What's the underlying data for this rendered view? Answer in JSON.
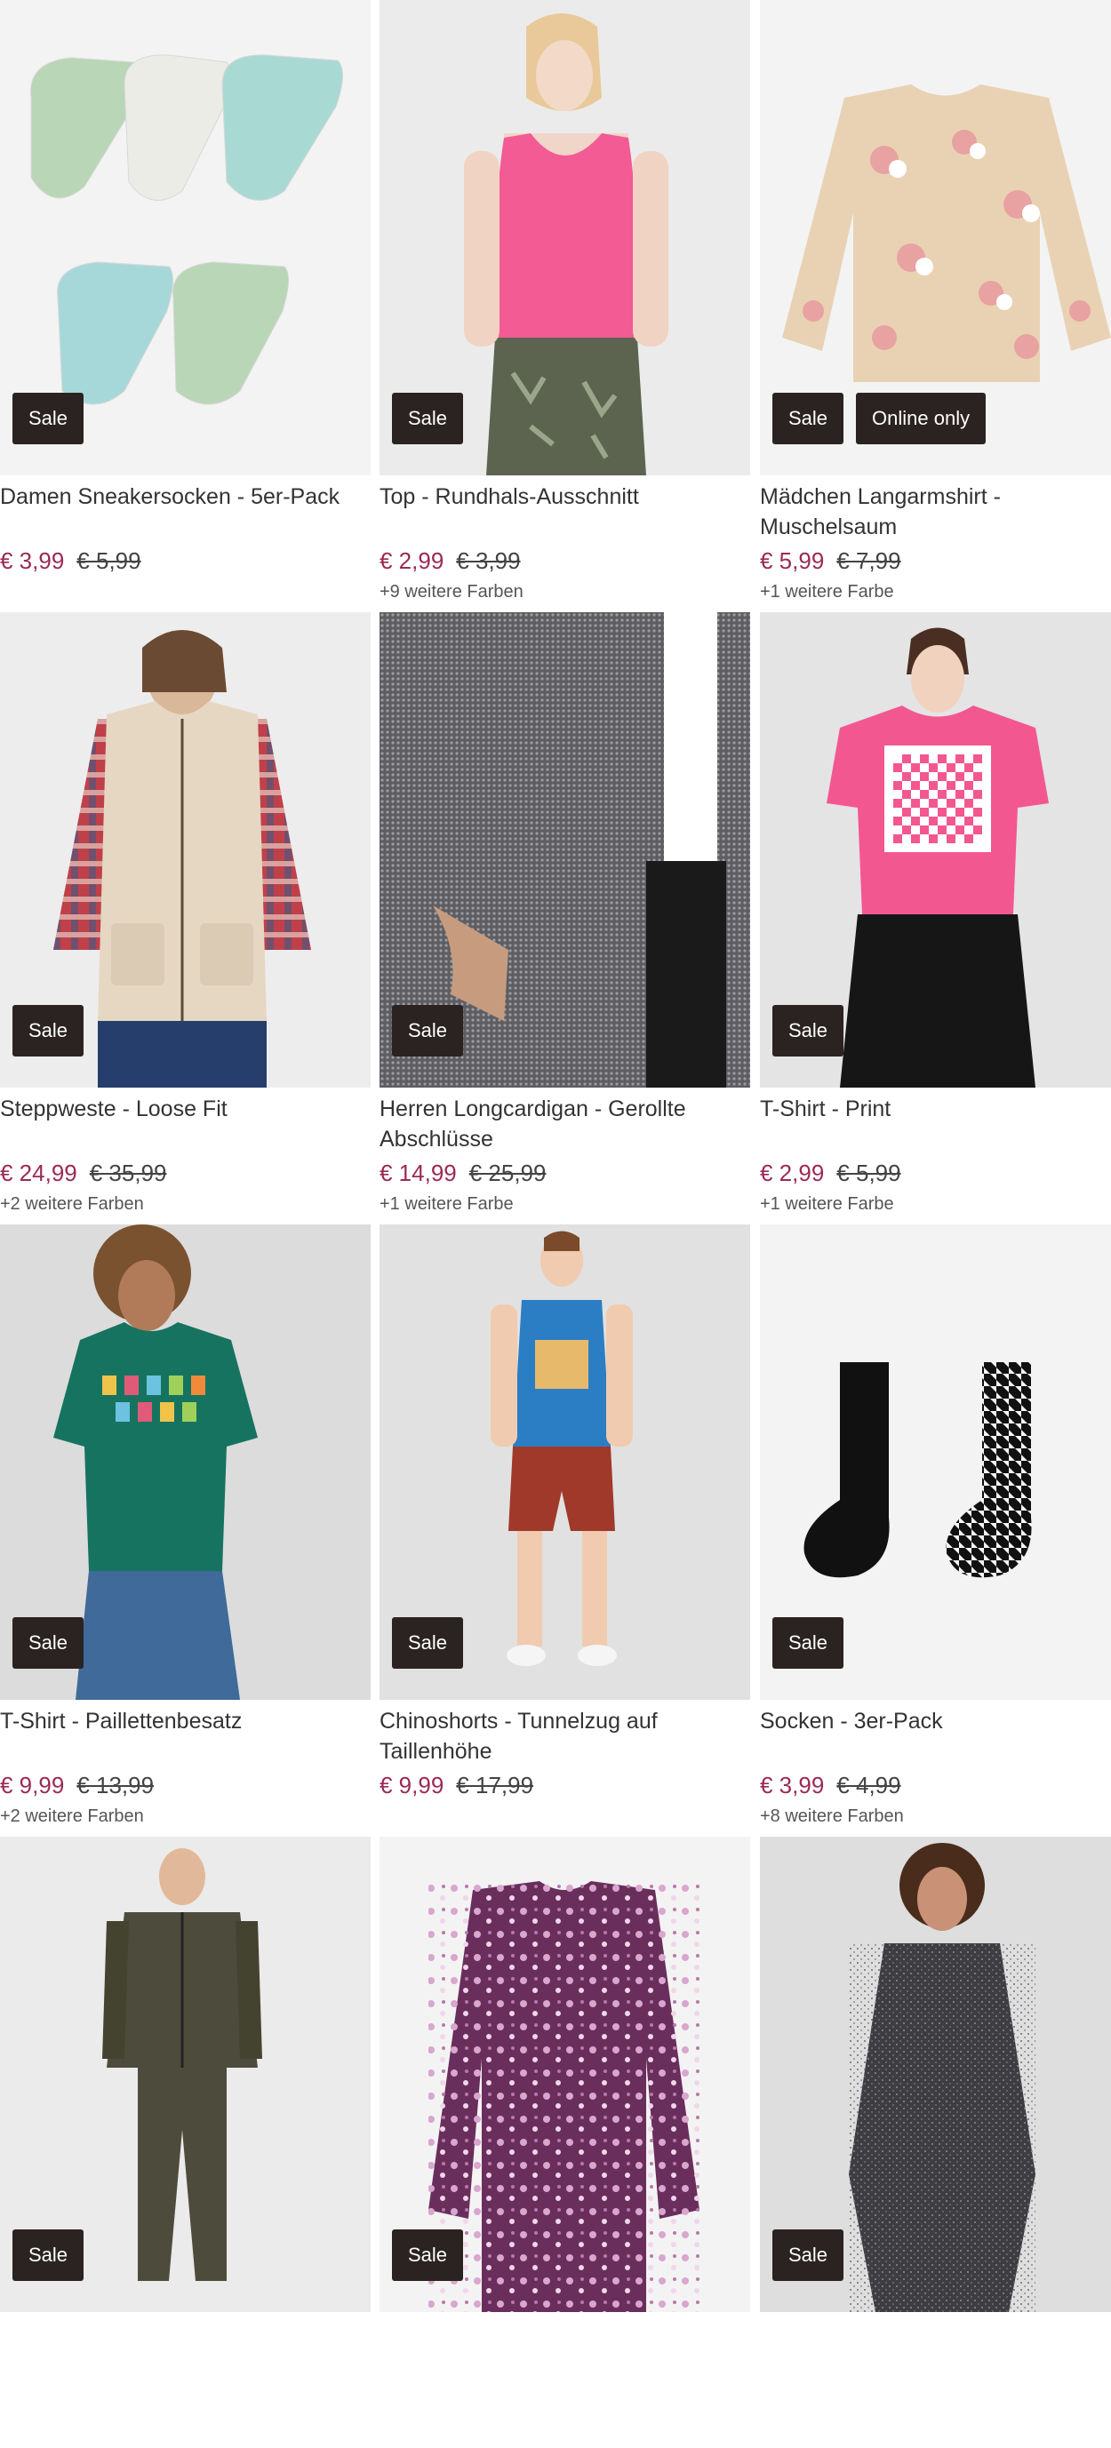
{
  "products": [
    {
      "title": "Damen Sneakersocken - 5er-Pack",
      "price": "€ 3,99",
      "old_price": "€ 5,99",
      "colors_text": "",
      "badges": [
        "Sale"
      ],
      "image": "sneaker-socks-image",
      "bg": "#f3f3f3"
    },
    {
      "title": "Top - Rundhals-Ausschnitt",
      "price": "€ 2,99",
      "old_price": "€ 3,99",
      "colors_text": "+9 weitere Farben",
      "badges": [
        "Sale"
      ],
      "image": "pink-top-image",
      "bg": "#ebebeb"
    },
    {
      "title": "Mädchen Langarmshirt - Muschelsaum",
      "price": "€ 5,99",
      "old_price": "€ 7,99",
      "colors_text": "+1 weitere Farbe",
      "badges": [
        "Sale",
        "Online only"
      ],
      "image": "unicorn-longsleeve-image",
      "bg": "#f3f3f3"
    },
    {
      "title": "Steppweste - Loose Fit",
      "price": "€ 24,99",
      "old_price": "€ 35,99",
      "colors_text": "+2 weitere Farben",
      "badges": [
        "Sale"
      ],
      "image": "puffer-vest-image",
      "bg": "#ededed"
    },
    {
      "title": "Herren Longcardigan - Gerollte Abschlüsse",
      "price": "€ 14,99",
      "old_price": "€ 25,99",
      "colors_text": "+1 weitere Farbe",
      "badges": [
        "Sale"
      ],
      "image": "knit-cardigan-image",
      "bg": "#e6e6e6"
    },
    {
      "title": "T-Shirt - Print",
      "price": "€ 2,99",
      "old_price": "€ 5,99",
      "colors_text": "+1 weitere Farbe",
      "badges": [
        "Sale"
      ],
      "image": "pink-print-tshirt-image",
      "bg": "#e4e4e4"
    },
    {
      "title": "T-Shirt - Paillettenbesatz",
      "price": "€ 9,99",
      "old_price": "€ 13,99",
      "colors_text": "+2 weitere Farben",
      "badges": [
        "Sale"
      ],
      "image": "green-sequin-tshirt-image",
      "bg": "#dcdcdc"
    },
    {
      "title": "Chinoshorts - Tunnelzug auf Taillenhöhe",
      "price": "€ 9,99",
      "old_price": "€ 17,99",
      "colors_text": "",
      "badges": [
        "Sale"
      ],
      "image": "chino-shorts-image",
      "bg": "#e1e1e1"
    },
    {
      "title": "Socken - 3er-Pack",
      "price": "€ 3,99",
      "old_price": "€ 4,99",
      "colors_text": "+8 weitere Farben",
      "badges": [
        "Sale"
      ],
      "image": "black-socks-image",
      "bg": "#f3f3f3"
    },
    {
      "title": "",
      "price": "",
      "old_price": "",
      "colors_text": "",
      "badges": [
        "Sale"
      ],
      "image": "tracksuit-image",
      "bg": "#ebebeb"
    },
    {
      "title": "",
      "price": "",
      "old_price": "",
      "colors_text": "",
      "badges": [
        "Sale"
      ],
      "image": "floral-longsleeve-image",
      "bg": "#f3f3f3"
    },
    {
      "title": "",
      "price": "",
      "old_price": "",
      "colors_text": "",
      "badges": [
        "Sale"
      ],
      "image": "glitter-dress-image",
      "bg": "#dedede"
    }
  ],
  "colors": {
    "sale_price": "#9b2a55",
    "badge_bg": "#2b2321",
    "badge_text": "#ffffff"
  }
}
